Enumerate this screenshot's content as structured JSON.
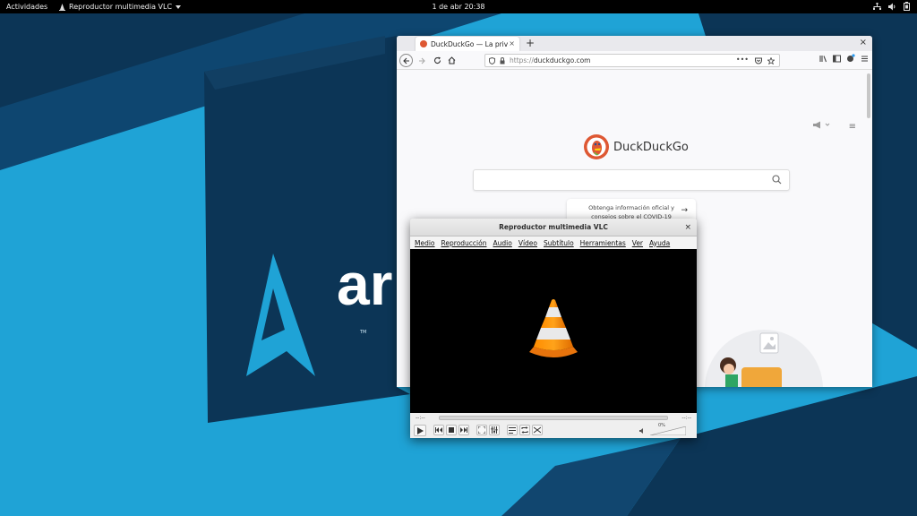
{
  "topbar": {
    "activities": "Actividades",
    "app_menu": "Reproductor multimedia VLC",
    "clock": "1 de abr  20:38"
  },
  "wallpaper": {
    "logo_text": "ar",
    "trademark": "TM",
    "colors": {
      "light": "#1fa3d6",
      "dark": "#0c3556",
      "mid": "#0e4670"
    }
  },
  "firefox": {
    "tab_title": "DuckDuckGo — La privacidad, simplificada.",
    "url_protocol": "https://",
    "url_host": "duckduckgo.com",
    "page": {
      "brand": "DuckDuckGo",
      "search_placeholder": "",
      "covid_line1": "Obtenga información oficial y",
      "covid_line2": "consejos sobre el COVID-19"
    }
  },
  "vlc": {
    "title": "Reproductor multimedia VLC",
    "menu": [
      "Medio",
      "Reproducción",
      "Audio",
      "Vídeo",
      "Subtítulo",
      "Herramientas",
      "Ver",
      "Ayuda"
    ],
    "time_elapsed": "--:--",
    "time_total": "--:--",
    "volume_percent": "0%",
    "volume_level": 0.0
  },
  "icons": {
    "topbar_tray": [
      "network-icon",
      "volume-icon",
      "battery-icon"
    ],
    "firefox_nav": [
      "back-icon",
      "forward-icon",
      "reload-icon",
      "home-icon"
    ],
    "vlc_controls": [
      "play-icon",
      "previous-icon",
      "stop-icon",
      "next-icon",
      "fullscreen-icon",
      "extended-settings-icon",
      "playlist-icon",
      "loop-icon",
      "shuffle-icon"
    ]
  }
}
